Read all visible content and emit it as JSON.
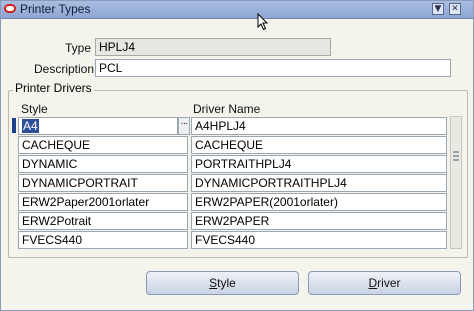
{
  "window": {
    "title": "Printer Types",
    "minimize_glyph": "▼",
    "close_glyph": "✕"
  },
  "form": {
    "type_label": "Type",
    "type_value": "HPLJ4",
    "description_label": "Description",
    "description_value": "PCL"
  },
  "drivers": {
    "group_title": "Printer Drivers",
    "col_style": "Style",
    "col_driver": "Driver Name",
    "lov_glyph": "···",
    "rows": [
      {
        "style": "A4",
        "driver": "A4HPLJ4"
      },
      {
        "style": "CACHEQUE",
        "driver": "CACHEQUE"
      },
      {
        "style": "DYNAMIC",
        "driver": "PORTRAITHPLJ4"
      },
      {
        "style": "DYNAMICPORTRAIT",
        "driver": "DYNAMICPORTRAITHPLJ4"
      },
      {
        "style": "ERW2Paper2001orlater",
        "driver": "ERW2PAPER(2001orlater)"
      },
      {
        "style": "ERW2Potrait",
        "driver": "ERW2PAPER"
      },
      {
        "style": "FVECS440",
        "driver": "FVECS440"
      }
    ]
  },
  "buttons": {
    "style_first": "S",
    "style_rest": "tyle",
    "driver_first": "D",
    "driver_rest": "river"
  },
  "colors": {
    "titlebar": "#a8bde0",
    "focus": "#2d4f9a",
    "brand_icon": "#d42222"
  }
}
